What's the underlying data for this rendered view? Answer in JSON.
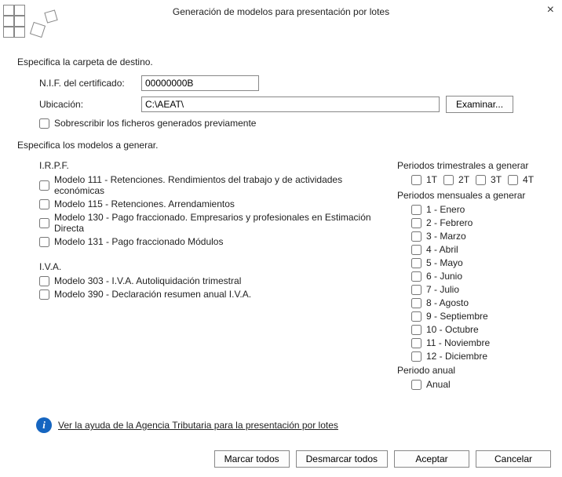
{
  "title": "Generación de modelos para presentación por lotes",
  "close_glyph": "×",
  "dest": {
    "section": "Especifica la carpeta de destino.",
    "nif_label": "N.I.F. del certificado:",
    "nif_value": "00000000B",
    "ubicacion_label": "Ubicación:",
    "ubicacion_value": "C:\\AEAT\\",
    "examinar": "Examinar...",
    "sobrescribir": "Sobrescribir los ficheros generados previamente"
  },
  "gen": {
    "section": "Especifica los modelos a generar.",
    "irpf": {
      "title": "I.R.P.F.",
      "items": [
        "Modelo 111 - Retenciones. Rendimientos del trabajo y de actividades económicas",
        "Modelo 115 - Retenciones. Arrendamientos",
        "Modelo 130 - Pago fraccionado. Empresarios y profesionales en Estimación Directa",
        "Modelo 131 - Pago fraccionado Módulos"
      ]
    },
    "iva": {
      "title": "I.V.A.",
      "items": [
        "Modelo 303 - I.V.A. Autoliquidación trimestral",
        "Modelo 390 - Declaración resumen anual I.V.A."
      ]
    }
  },
  "periods": {
    "quarter_title": "Periodos trimestrales a generar",
    "quarters": [
      "1T",
      "2T",
      "3T",
      "4T"
    ],
    "month_title": "Periodos mensuales a generar",
    "months": [
      "1 - Enero",
      "2 - Febrero",
      "3 - Marzo",
      "4 - Abril",
      "5 - Mayo",
      "6 - Junio",
      "7 - Julio",
      "8 - Agosto",
      "9 - Septiembre",
      "10 - Octubre",
      "11 - Noviembre",
      "12 - Diciembre"
    ],
    "annual_title": "Periodo anual",
    "annual": "Anual"
  },
  "help": {
    "icon_glyph": "i",
    "text": "Ver la ayuda de la Agencia Tributaria para la presentación por lotes"
  },
  "footer": {
    "marcar": "Marcar todos",
    "desmarcar": "Desmarcar todos",
    "aceptar": "Aceptar",
    "cancelar": "Cancelar"
  }
}
